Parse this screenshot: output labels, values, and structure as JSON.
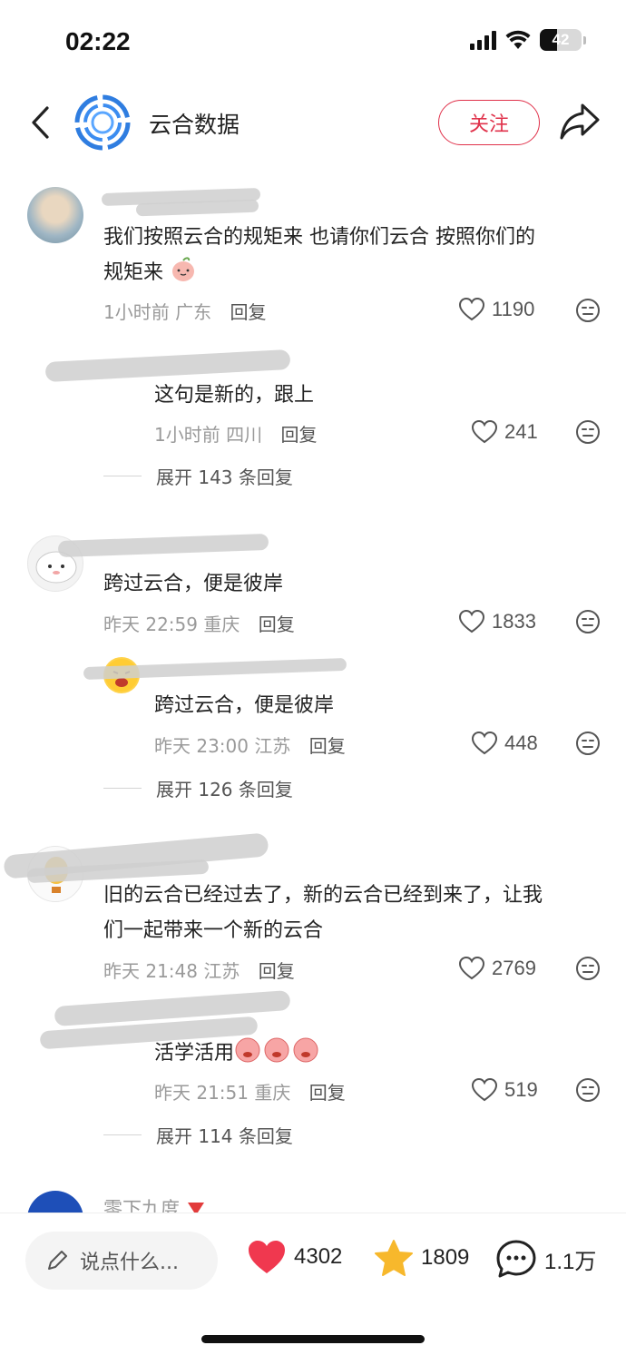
{
  "status_bar": {
    "time": "02:22",
    "battery_level": "42"
  },
  "header": {
    "account_name": "云合数据",
    "follow_label": "关注"
  },
  "comments": [
    {
      "text_lines": [
        "我们按照云合的规矩来 也请你们云合 按照你们的",
        "规矩来"
      ],
      "time": "1小时前",
      "location": "广东",
      "reply_label": "回复",
      "likes": "1190",
      "replies": [
        {
          "text": "这句是新的，跟上",
          "time": "1小时前",
          "location": "四川",
          "reply_label": "回复",
          "likes": "241"
        }
      ],
      "expand_label": "展开 143 条回复"
    },
    {
      "text_lines": [
        "跨过云合，便是彼岸"
      ],
      "time": "昨天 22:59",
      "location": "重庆",
      "reply_label": "回复",
      "likes": "1833",
      "replies": [
        {
          "text": "跨过云合，便是彼岸",
          "time": "昨天 23:00",
          "location": "江苏",
          "reply_label": "回复",
          "likes": "448"
        }
      ],
      "expand_label": "展开 126 条回复"
    },
    {
      "text_lines": [
        "旧的云合已经过去了，新的云合已经到来了，让我",
        "们一起带来一个新的云合"
      ],
      "time": "昨天 21:48",
      "location": "江苏",
      "reply_label": "回复",
      "likes": "2769",
      "replies": [
        {
          "text": "活学活用",
          "time": "昨天 21:51",
          "location": "重庆",
          "reply_label": "回复",
          "likes": "519"
        }
      ],
      "expand_label": "展开 114 条回复"
    },
    {
      "username": "零下九度"
    }
  ],
  "bottom_bar": {
    "input_placeholder": "说点什么...",
    "likes": "4302",
    "favorites": "1809",
    "comments": "1.1万"
  },
  "colors": {
    "accent": "#e0324b",
    "heart": "#f0384f",
    "star": "#f7b82c",
    "logo_blue": "#2f7de0"
  }
}
